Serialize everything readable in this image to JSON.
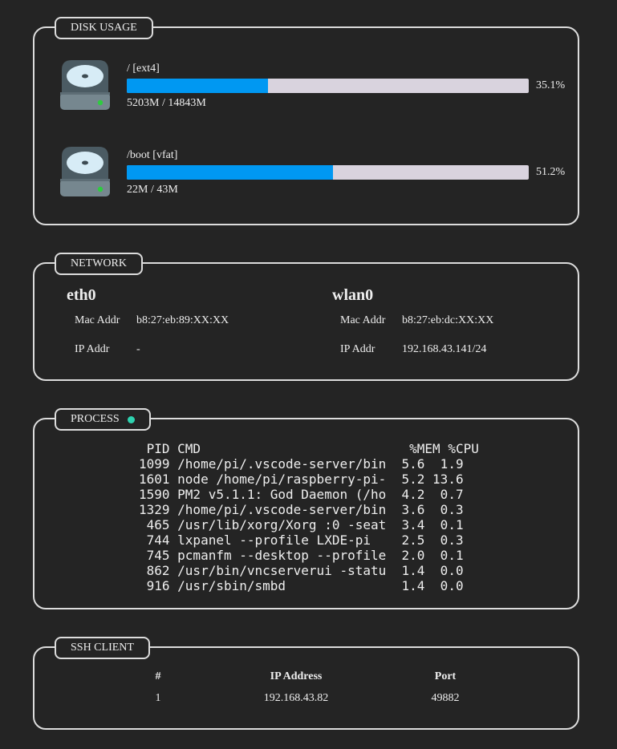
{
  "colors": {
    "bar_fill": "#0098f2",
    "bar_track": "#d9d3de",
    "drive_led": "#2ecc40",
    "process_status_dot": "#2ed3b0"
  },
  "disk": {
    "title": "DISK USAGE",
    "items": [
      {
        "icon": "hard-drive-icon",
        "label": "/ [ext4]",
        "percent_text": "35.1%",
        "percent": 35.1,
        "sizes": "5203M / 14843M"
      },
      {
        "icon": "hard-drive-icon",
        "label": "/boot [vfat]",
        "percent_text": "51.2%",
        "percent": 51.2,
        "sizes": "22M / 43M"
      }
    ]
  },
  "network": {
    "title": "NETWORK",
    "interfaces": [
      {
        "name": "eth0",
        "mac_label": "Mac Addr",
        "mac": "b8:27:eb:89:XX:XX",
        "ip_label": "IP Addr",
        "ip": "-"
      },
      {
        "name": "wlan0",
        "mac_label": "Mac Addr",
        "mac": "b8:27:eb:dc:XX:XX",
        "ip_label": "IP Addr",
        "ip": "192.168.43.141/24"
      }
    ]
  },
  "process": {
    "title": "PROCESS",
    "status_icon": "status-dot-icon",
    "text": " PID CMD                           %MEM %CPU\n1099 /home/pi/.vscode-server/bin  5.6  1.9\n1601 node /home/pi/raspberry-pi-  5.2 13.6\n1590 PM2 v5.1.1: God Daemon (/ho  4.2  0.7\n1329 /home/pi/.vscode-server/bin  3.6  0.3\n 465 /usr/lib/xorg/Xorg :0 -seat  3.4  0.1\n 744 lxpanel --profile LXDE-pi    2.5  0.3\n 745 pcmanfm --desktop --profile  2.0  0.1\n 862 /usr/bin/vncserverui -statu  1.4  0.0\n 916 /usr/sbin/smbd               1.4  0.0"
  },
  "ssh": {
    "title": "SSH CLIENT",
    "headers": [
      "#",
      "IP Address",
      "Port"
    ],
    "rows": [
      [
        "1",
        "192.168.43.82",
        "49882"
      ]
    ]
  }
}
